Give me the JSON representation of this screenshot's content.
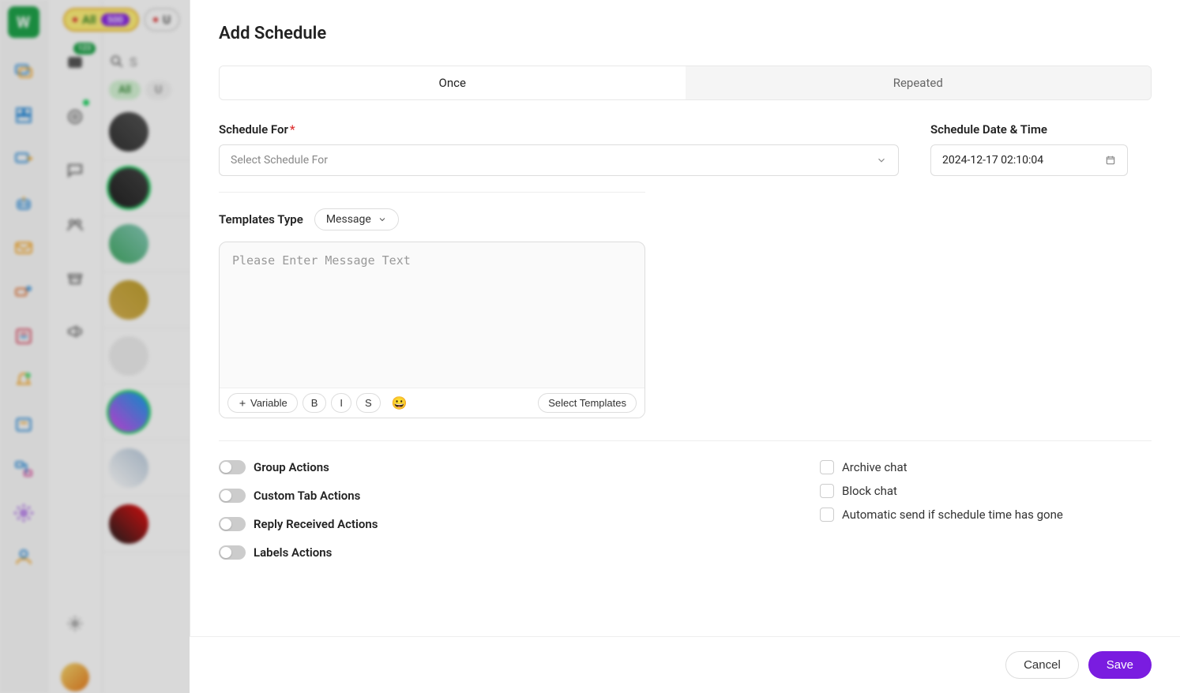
{
  "header": {
    "pill_all_label": "All",
    "pill_all_count": "500",
    "pill_u_label": "U"
  },
  "col2": {
    "badge": "123"
  },
  "chatlist": {
    "search_placeholder": "S",
    "filter_all": "All",
    "filter_u": "U"
  },
  "modal": {
    "title": "Add Schedule",
    "tab_once": "Once",
    "tab_repeated": "Repeated",
    "schedule_for_label": "Schedule For",
    "schedule_for_placeholder": "Select Schedule For",
    "schedule_date_label": "Schedule Date & Time",
    "schedule_date_value": "2024-12-17 02:10:04",
    "templates_type_label": "Templates Type",
    "templates_type_value": "Message",
    "editor_placeholder": "Please Enter Message Text",
    "toolbar": {
      "variable": "Variable",
      "bold": "B",
      "italic": "I",
      "strike": "S",
      "emoji": "😀",
      "select_templates": "Select Templates"
    },
    "toggles": {
      "group_actions": "Group Actions",
      "custom_tab": "Custom Tab Actions",
      "reply_received": "Reply Received Actions",
      "labels_actions": "Labels Actions"
    },
    "checks": {
      "archive": "Archive chat",
      "block": "Block chat",
      "auto_send": "Automatic send if schedule time has gone"
    },
    "cancel": "Cancel",
    "save": "Save"
  }
}
